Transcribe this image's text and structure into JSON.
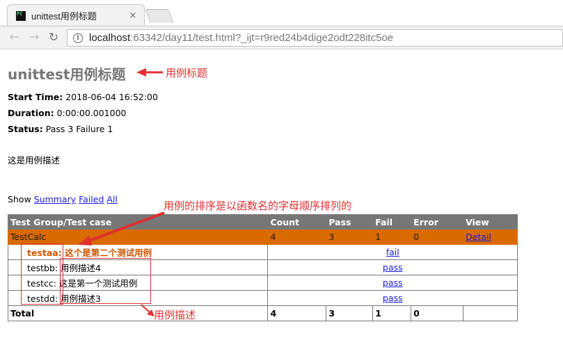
{
  "browser": {
    "tab_title": "unittest用例标题",
    "tab_close": "×",
    "url_host": "localhost",
    "url_path": ":63342/day11/test.html?_ijt=r9red24b4dige2odt228itc5oe"
  },
  "report": {
    "heading": "unittest用例标题",
    "start_time_label": "Start Time:",
    "start_time_value": "2018-06-04 16:52:00",
    "duration_label": "Duration:",
    "duration_value": "0:00:00.001000",
    "status_label": "Status:",
    "status_value": "Pass 3 Failure 1",
    "description": "这是用例描述",
    "show": {
      "label": "Show",
      "summary": "Summary",
      "failed": "Failed",
      "all": "All"
    },
    "table": {
      "headers": [
        "Test Group/Test case",
        "Count",
        "Pass",
        "Fail",
        "Error",
        "View"
      ],
      "class_row": {
        "name": "TestCalc",
        "count": "4",
        "pass": "3",
        "fail": "1",
        "error": "0",
        "view": "Detail"
      },
      "cases": [
        {
          "name": "testaa: 这个是第二个测试用例",
          "status": "fail"
        },
        {
          "name": "testbb: 用例描述4",
          "status": "pass"
        },
        {
          "name": "testcc: 这是第一个测试用例",
          "status": "pass"
        },
        {
          "name": "testdd: 用例描述3",
          "status": "pass"
        }
      ],
      "total_row": {
        "label": "Total",
        "count": "4",
        "pass": "3",
        "fail": "1",
        "error": "0"
      }
    }
  },
  "annotations": {
    "title_note": "用例标题",
    "order_note": "用例的排序是以函数名的字母顺序排列的",
    "desc_note": "用例描述",
    "color": "#e03030"
  },
  "colors": {
    "header_bg": "#777777",
    "class_row_bg": "#d96a00",
    "link": "#1a1adb",
    "heading_text": "#777777"
  }
}
